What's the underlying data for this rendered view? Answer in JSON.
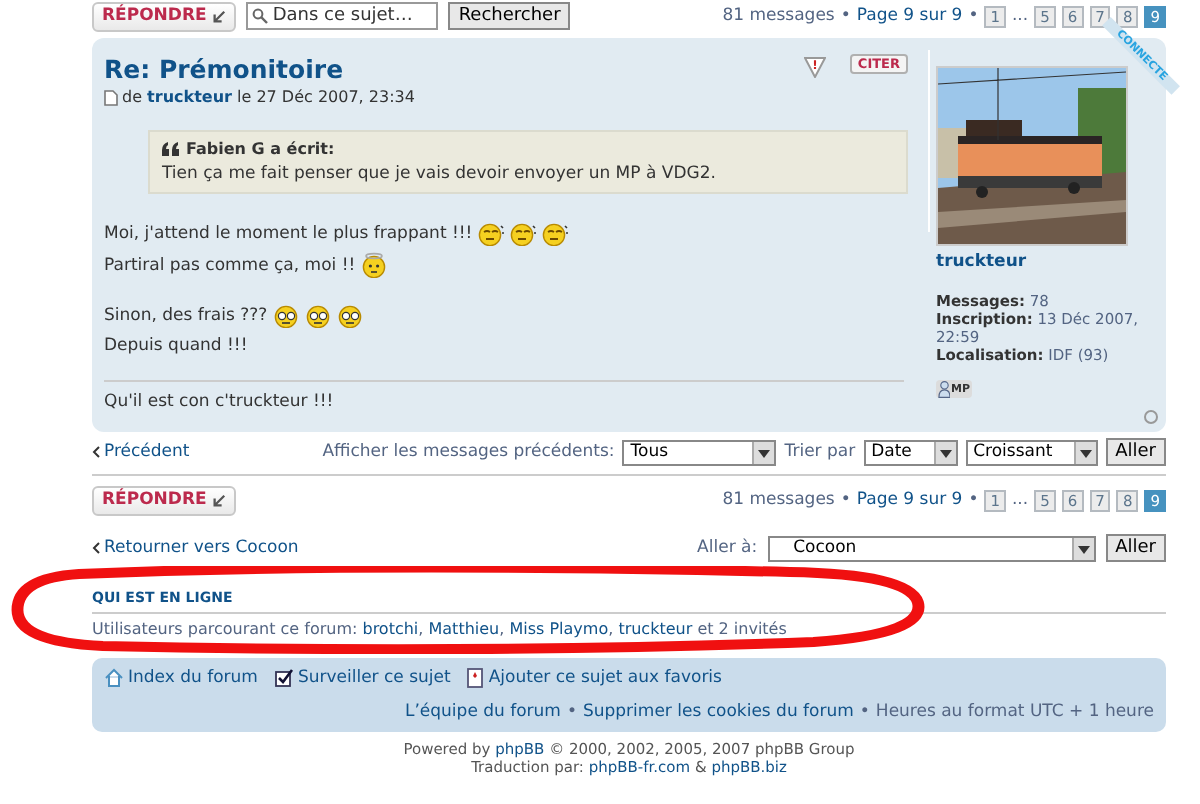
{
  "top_bar": {
    "reply_button": "RÉPONDRE",
    "search": {
      "placeholder": "Dans ce sujet…"
    },
    "search_button": "Rechercher"
  },
  "pagination_top": {
    "count": "81 messages",
    "bullet": "•",
    "page_label": "Page 9 sur 9",
    "pages": [
      {
        "kind": "page",
        "label": "1",
        "selected": false
      },
      {
        "kind": "ellipsis",
        "label": "..."
      },
      {
        "kind": "page",
        "label": "5",
        "selected": false
      },
      {
        "kind": "page",
        "label": "6",
        "selected": false
      },
      {
        "kind": "page",
        "label": "7",
        "selected": false
      },
      {
        "kind": "page",
        "label": "8",
        "selected": false
      },
      {
        "kind": "page",
        "label": "9",
        "selected": true
      }
    ]
  },
  "post": {
    "title": "Re: Prémonitoire",
    "byline": {
      "prefix": "de",
      "author": "truckteur",
      "date": "le 27 Déc 2007, 23:34"
    },
    "report_button": "!",
    "quote_button": "CITER",
    "quote": {
      "author": "Fabien G a écrit:",
      "text": "Tien ça me fait penser que je vais devoir envoyer un MP à VDG2."
    },
    "paragraphs": [
      {
        "lines": [
          {
            "text": "Moi, j'attend le moment le plus frappant !!!",
            "smileys": [
              {
                "kind": "sleepy"
              },
              {
                "kind": "sleepy"
              },
              {
                "kind": "sleepy"
              }
            ]
          },
          {
            "text": "Partiral pas comme ça, moi !!",
            "smileys": [
              {
                "kind": "angel"
              }
            ]
          }
        ]
      },
      {
        "lines": [
          {
            "text": "Sinon, des frais ???",
            "smileys": [
              {
                "kind": "squint"
              },
              {
                "kind": "squint"
              },
              {
                "kind": "squint"
              }
            ]
          },
          {
            "text": "Depuis quand !!!"
          }
        ]
      }
    ],
    "signature": "Qu'il est con c'truckteur !!!",
    "profile": {
      "status": "CONNECTE",
      "name": "truckteur",
      "fields": [
        {
          "label": "Messages:",
          "value": "78"
        },
        {
          "label": "Inscription:",
          "value": "13 Déc 2007, 22:59"
        },
        {
          "label": "Localisation:",
          "value": "IDF (93)"
        }
      ],
      "pm_button": "MP"
    }
  },
  "display_options": {
    "previous": "Précédent",
    "show_label": "Afficher les messages précédents:",
    "show_value": "Tous",
    "sort_label": "Trier par",
    "sort_key": "Date",
    "sort_order": "Croissant",
    "go": "Aller"
  },
  "bottom_bar": {
    "reply_button": "RÉPONDRE"
  },
  "pagination_bottom": {
    "count": "81 messages",
    "bullet": "•",
    "page_label": "Page 9 sur 9",
    "pages": [
      {
        "kind": "page",
        "label": "1",
        "selected": false
      },
      {
        "kind": "ellipsis",
        "label": "..."
      },
      {
        "kind": "page",
        "label": "5",
        "selected": false
      },
      {
        "kind": "page",
        "label": "6",
        "selected": false
      },
      {
        "kind": "page",
        "label": "7",
        "selected": false
      },
      {
        "kind": "page",
        "label": "8",
        "selected": false
      },
      {
        "kind": "page",
        "label": "9",
        "selected": true
      }
    ]
  },
  "jump": {
    "back_link": "Retourner vers Cocoon",
    "label": "Aller à:",
    "value": "Cocoon",
    "go": "Aller"
  },
  "online": {
    "heading": "QUI EST EN LIGNE",
    "prefix": "Utilisateurs parcourant ce forum:",
    "users": [
      "brotchi",
      "Matthieu",
      "Miss Playmo",
      "truckteur"
    ],
    "separator": ",",
    "suffix": "et 2 invités"
  },
  "footer": {
    "links": [
      {
        "kind": "home",
        "label": "Index du forum"
      },
      {
        "kind": "watch",
        "label": "Surveiller ce sujet"
      },
      {
        "kind": "bookmark",
        "label": "Ajouter ce sujet aux favoris"
      }
    ],
    "separator": "•",
    "right": [
      "L’équipe du forum",
      "Supprimer les cookies du forum",
      "Heures au format UTC + 1 heure"
    ]
  },
  "credits": {
    "line1": {
      "prefix": "Powered by",
      "link": "phpBB",
      "suffix": "© 2000, 2002, 2005, 2007 phpBB Group"
    },
    "line2": {
      "prefix": "Traduction par:",
      "link1": "phpBB-fr.com",
      "mid": "&",
      "link2": "phpBB.biz"
    }
  }
}
